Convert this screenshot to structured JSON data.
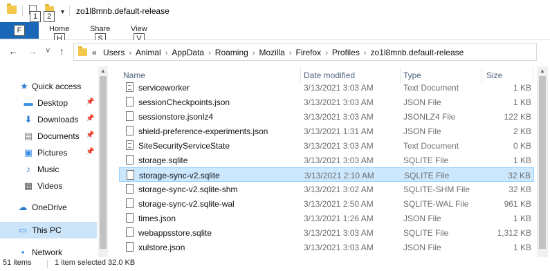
{
  "titlebar": {
    "title": "zo1l8mnb.default-release",
    "keytip_1": "1",
    "keytip_2": "2"
  },
  "ribbon": {
    "file_keytip": "F",
    "tabs": [
      {
        "label": "Home",
        "keytip": "H"
      },
      {
        "label": "Share",
        "keytip": "S"
      },
      {
        "label": "View",
        "keytip": "V"
      }
    ]
  },
  "nav": {
    "back": "←",
    "forward": "→",
    "recent": "˅",
    "up": "↑",
    "overflow": "«",
    "breadcrumbs": [
      "Users",
      "Animal",
      "AppData",
      "Roaming",
      "Mozilla",
      "Firefox",
      "Profiles",
      "zo1l8mnb.default-release"
    ],
    "separator": "›"
  },
  "sidebar": {
    "items": [
      {
        "label": "Quick access",
        "icon": "star-icon",
        "glyph": "★",
        "color": "#2b7cd3",
        "pinned": false
      },
      {
        "label": "Desktop",
        "icon": "desktop-icon",
        "glyph": "▬",
        "color": "#3a8ee6",
        "pinned": true
      },
      {
        "label": "Downloads",
        "icon": "download-icon",
        "glyph": "⬇",
        "color": "#2b7cd3",
        "pinned": true
      },
      {
        "label": "Documents",
        "icon": "documents-icon",
        "glyph": "▤",
        "color": "#7a7a7a",
        "pinned": true
      },
      {
        "label": "Pictures",
        "icon": "pictures-icon",
        "glyph": "▣",
        "color": "#3a8ee6",
        "pinned": true
      },
      {
        "label": "Music",
        "icon": "music-icon",
        "glyph": "♪",
        "color": "#2b7cd3",
        "pinned": false
      },
      {
        "label": "Videos",
        "icon": "videos-icon",
        "glyph": "▦",
        "color": "#555555",
        "pinned": false
      },
      {
        "label": "OneDrive",
        "icon": "cloud-icon",
        "glyph": "☁",
        "color": "#2b7cd3",
        "pinned": false
      },
      {
        "label": "This PC",
        "icon": "computer-icon",
        "glyph": "▭",
        "color": "#3a8ee6",
        "pinned": false,
        "selected": true
      },
      {
        "label": "Network",
        "icon": "network-icon",
        "glyph": "▪",
        "color": "#3a8ee6",
        "pinned": false
      }
    ],
    "pin_glyph": "📌"
  },
  "columns": {
    "name": "Name",
    "date": "Date modified",
    "type": "Type",
    "size": "Size"
  },
  "files": [
    {
      "name": "serviceworker",
      "date": "3/13/2021 3:03 AM",
      "type": "Text Document",
      "size": "1 KB",
      "icon": "text-document-icon"
    },
    {
      "name": "sessionCheckpoints.json",
      "date": "3/13/2021 3:03 AM",
      "type": "JSON File",
      "size": "1 KB",
      "icon": "file-icon"
    },
    {
      "name": "sessionstore.jsonlz4",
      "date": "3/13/2021 3:03 AM",
      "type": "JSONLZ4 File",
      "size": "122 KB",
      "icon": "file-icon"
    },
    {
      "name": "shield-preference-experiments.json",
      "date": "3/13/2021 1:31 AM",
      "type": "JSON File",
      "size": "2 KB",
      "icon": "file-icon"
    },
    {
      "name": "SiteSecurityServiceState",
      "date": "3/13/2021 3:03 AM",
      "type": "Text Document",
      "size": "0 KB",
      "icon": "text-document-icon"
    },
    {
      "name": "storage.sqlite",
      "date": "3/13/2021 3:03 AM",
      "type": "SQLITE File",
      "size": "1 KB",
      "icon": "file-icon"
    },
    {
      "name": "storage-sync-v2.sqlite",
      "date": "3/13/2021 2:10 AM",
      "type": "SQLITE File",
      "size": "32 KB",
      "icon": "file-icon",
      "selected": true
    },
    {
      "name": "storage-sync-v2.sqlite-shm",
      "date": "3/13/2021 3:02 AM",
      "type": "SQLITE-SHM File",
      "size": "32 KB",
      "icon": "file-icon"
    },
    {
      "name": "storage-sync-v2.sqlite-wal",
      "date": "3/13/2021 2:50 AM",
      "type": "SQLITE-WAL File",
      "size": "961 KB",
      "icon": "file-icon"
    },
    {
      "name": "times.json",
      "date": "3/13/2021 1:26 AM",
      "type": "JSON File",
      "size": "1 KB",
      "icon": "file-icon"
    },
    {
      "name": "webappsstore.sqlite",
      "date": "3/13/2021 3:03 AM",
      "type": "SQLITE File",
      "size": "1,312 KB",
      "icon": "file-icon"
    },
    {
      "name": "xulstore.json",
      "date": "3/13/2021 3:03 AM",
      "type": "JSON File",
      "size": "1 KB",
      "icon": "file-icon"
    }
  ],
  "status": {
    "item_count": "51 items",
    "selection": "1 item selected  32.0 KB"
  },
  "colors": {
    "accent": "#1a67b8",
    "selection_bg": "#cce8ff",
    "selection_border": "#99d1ff",
    "nav_selected": "#cce4f7"
  }
}
